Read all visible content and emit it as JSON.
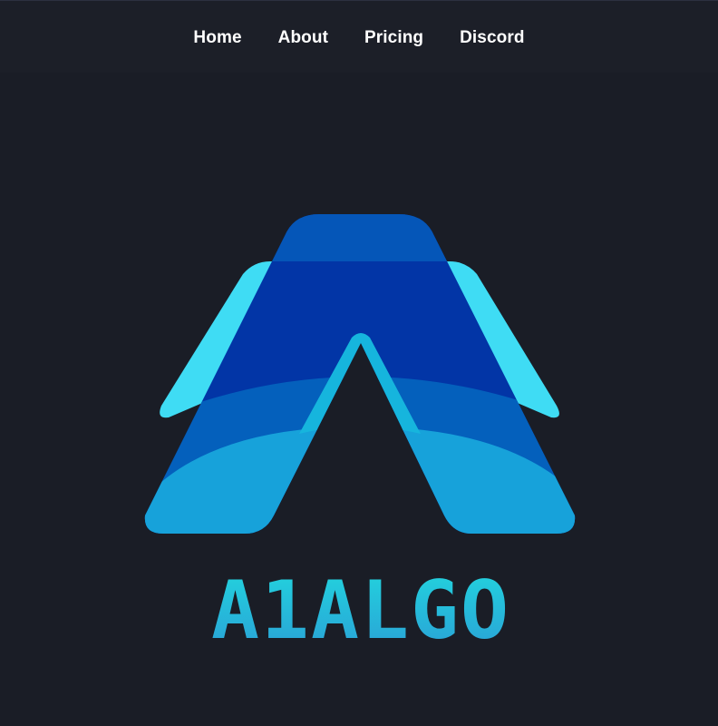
{
  "nav": {
    "links": [
      {
        "label": "Home"
      },
      {
        "label": "About"
      },
      {
        "label": "Pricing"
      },
      {
        "label": "Discord"
      }
    ]
  },
  "brand": {
    "wordmark": "A1ALGO",
    "colors": {
      "cyan": "#3fdcf4",
      "navy": "#0235a6",
      "blue": "#0460bc",
      "light_blue": "#17a2da",
      "wordmark_top": "#22d6de",
      "wordmark_bottom": "#2a9fd6"
    }
  }
}
